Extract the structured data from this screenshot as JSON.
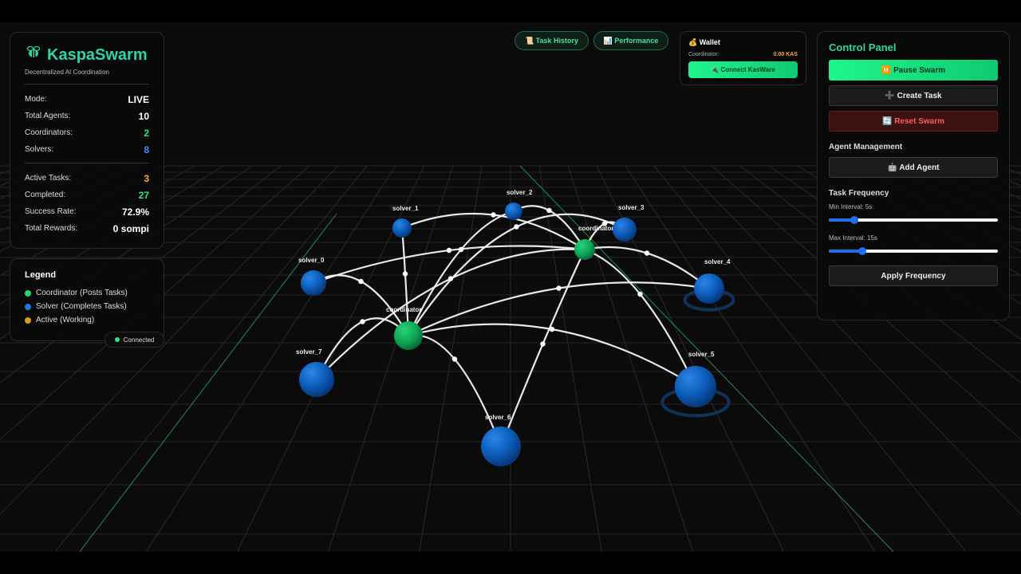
{
  "app": {
    "brand": "KaspaSwarm",
    "tagline": "Decentralized AI Coordination",
    "brand_icon": "bee-icon"
  },
  "stats": {
    "mode_label": "Mode:",
    "mode_value": "LIVE",
    "total_agents_label": "Total Agents:",
    "total_agents_value": "10",
    "coordinators_label": "Coordinators:",
    "coordinators_value": "2",
    "solvers_label": "Solvers:",
    "solvers_value": "8",
    "active_tasks_label": "Active Tasks:",
    "active_tasks_value": "3",
    "completed_label": "Completed:",
    "completed_value": "27",
    "success_rate_label": "Success Rate:",
    "success_rate_value": "72.9%",
    "total_rewards_label": "Total Rewards:",
    "total_rewards_value": "0 sompi"
  },
  "legend": {
    "title": "Legend",
    "items": [
      {
        "label": "Coordinator (Posts Tasks)",
        "color": "#20d66f"
      },
      {
        "label": "Solver (Completes Tasks)",
        "color": "#1f7ae0"
      },
      {
        "label": "Active (Working)",
        "color": "#e09a1f"
      }
    ]
  },
  "connection": {
    "label": "Connected",
    "color": "#2ee38a"
  },
  "top_nav": {
    "task_history": "📜 Task History",
    "performance": "📊 Performance"
  },
  "wallet": {
    "title": "💰 Wallet",
    "coordinator_label": "Coordinator:",
    "coordinator_amount": "0.00 KAS",
    "connect_button": "🔌 Connect KasWare"
  },
  "control_panel": {
    "title": "Control Panel",
    "pause_button": "⏸️ Pause Swarm",
    "create_task_button": "➕ Create Task",
    "reset_button": "🔄 Reset Swarm",
    "agent_management_title": "Agent Management",
    "add_agent_button": "🤖 Add Agent",
    "task_frequency_title": "Task Frequency",
    "min_interval_label": "Min Interval: 5s",
    "min_interval_fraction": 0.15,
    "max_interval_label": "Max Interval: 15s",
    "max_interval_fraction": 0.2,
    "apply_button": "Apply Frequency"
  },
  "scene": {
    "nodes": [
      {
        "id": "coordinator",
        "label": "coordinator",
        "type": "coordinator"
      },
      {
        "id": "coordinator_1",
        "label": "coordinator_1",
        "type": "coordinator"
      },
      {
        "id": "solver_0",
        "label": "solver_0",
        "type": "solver"
      },
      {
        "id": "solver_1",
        "label": "solver_1",
        "type": "solver"
      },
      {
        "id": "solver_2",
        "label": "solver_2",
        "type": "solver"
      },
      {
        "id": "solver_3",
        "label": "solver_3",
        "type": "solver"
      },
      {
        "id": "solver_4",
        "label": "solver_4",
        "type": "solver"
      },
      {
        "id": "solver_5",
        "label": "solver_5",
        "type": "solver"
      },
      {
        "id": "solver_6",
        "label": "solver_6",
        "type": "solver"
      },
      {
        "id": "solver_7",
        "label": "solver_7",
        "type": "solver"
      }
    ]
  }
}
